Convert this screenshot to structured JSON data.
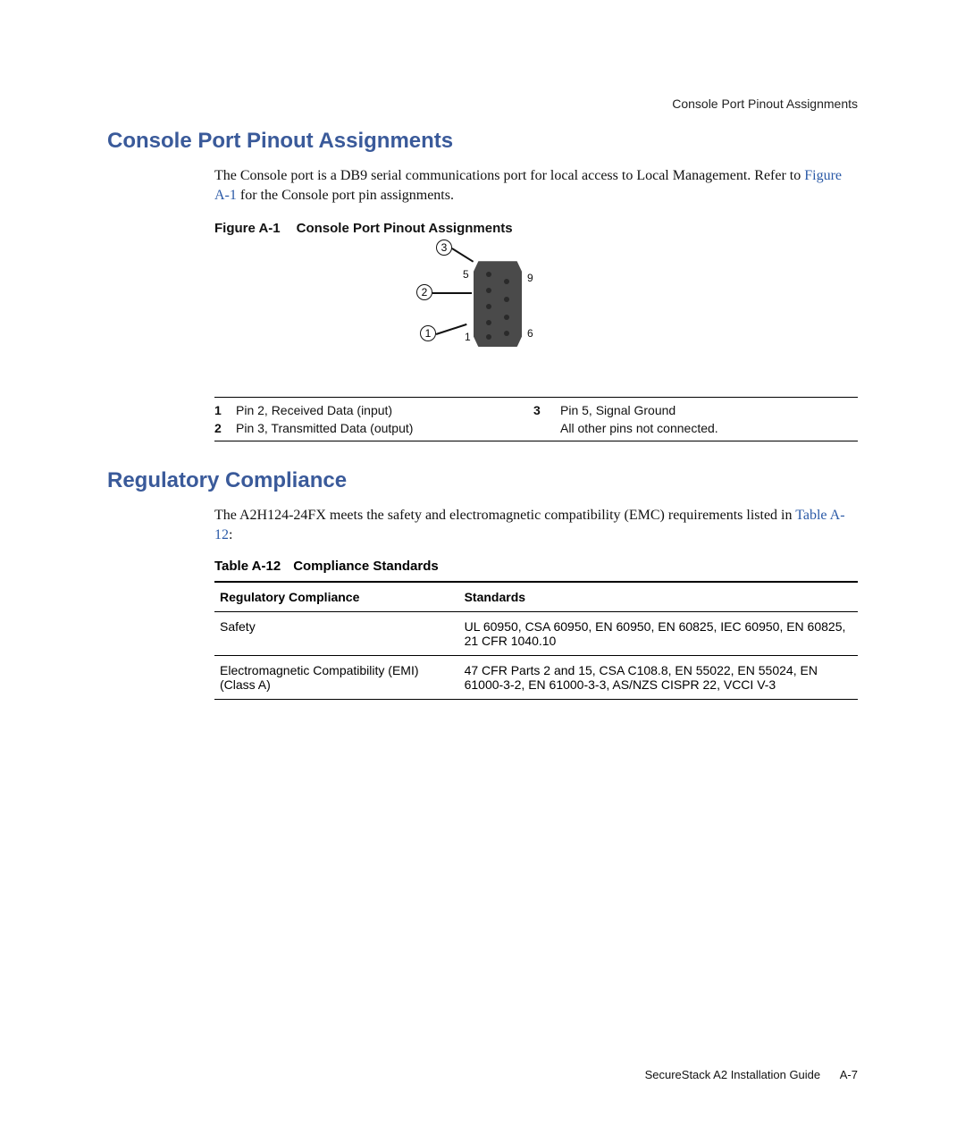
{
  "running_header": "Console Port Pinout Assignments",
  "section1": {
    "title": "Console Port Pinout Assignments",
    "para_a": "The Console port is a DB9 serial communications port for local access to Local Management. Refer to ",
    "link": "Figure A-1",
    "para_b": " for the Console port pin assignments."
  },
  "figure": {
    "label": "Figure A-1",
    "title": "Console Port Pinout Assignments",
    "callouts": {
      "c1": "1",
      "c2": "2",
      "c3": "3"
    },
    "pin_labels": {
      "top_left": "5",
      "top_right": "9",
      "bot_left": "1",
      "bot_right": "6"
    }
  },
  "legend": {
    "r1n": "1",
    "r1t": "Pin 2, Received Data (input)",
    "r1n2": "3",
    "r1t2": "Pin 5, Signal Ground",
    "r2n": "2",
    "r2t": "Pin 3, Transmitted Data (output)",
    "r2n2": "",
    "r2t2": "All other pins not connected."
  },
  "section2": {
    "title": "Regulatory Compliance",
    "para_a": "The A2H124-24FX meets the safety and electromagnetic compatibility (EMC) requirements listed in ",
    "link": "Table A-12",
    "para_b": ":"
  },
  "table": {
    "label": "Table A-12",
    "title": "Compliance Standards",
    "headers": {
      "c1": "Regulatory Compliance",
      "c2": "Standards"
    },
    "rows": [
      {
        "c1": "Safety",
        "c2": "UL 60950, CSA 60950, EN 60950, EN 60825, IEC 60950, EN 60825, 21 CFR 1040.10"
      },
      {
        "c1": "Electromagnetic Compatibility (EMI) (Class A)",
        "c2": "47 CFR Parts 2 and 15, CSA C108.8, EN 55022, EN 55024, EN 61000-3-2, EN 61000-3-3, AS/NZS CISPR 22, VCCI V-3"
      }
    ]
  },
  "footer": {
    "doc": "SecureStack A2 Installation Guide",
    "page": "A-7"
  }
}
